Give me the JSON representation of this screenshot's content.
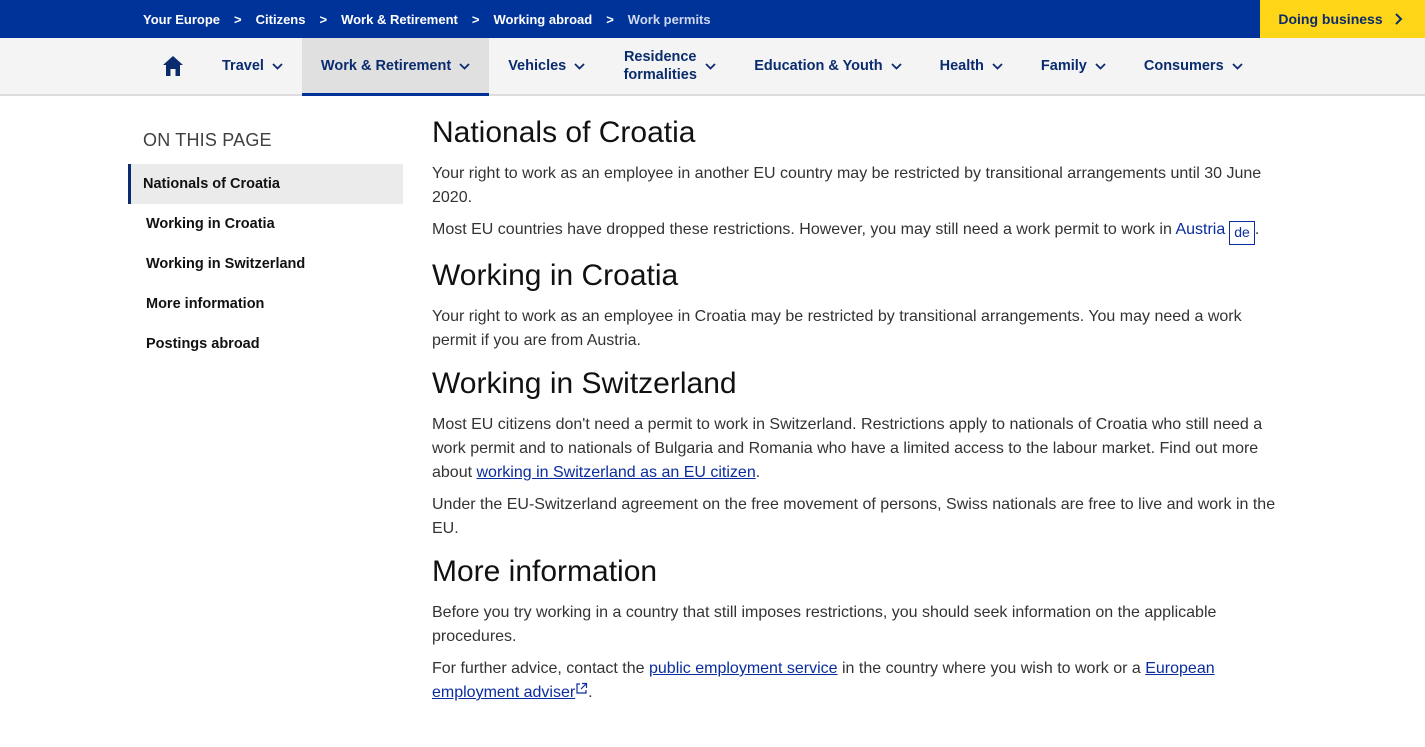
{
  "breadcrumb": {
    "items": [
      "Your Europe",
      "Citizens",
      "Work & Retirement",
      "Working abroad"
    ],
    "current": "Work permits",
    "separator": ">"
  },
  "doing_business": {
    "label": "Doing business"
  },
  "nav": {
    "home_icon": "home-icon",
    "items": [
      {
        "label": "Travel"
      },
      {
        "label": "Work & Retirement"
      },
      {
        "label": "Vehicles"
      },
      {
        "label": "Residence formalities"
      },
      {
        "label": "Education & Youth"
      },
      {
        "label": "Health"
      },
      {
        "label": "Family"
      },
      {
        "label": "Consumers"
      }
    ]
  },
  "sidebar": {
    "title": "ON THIS PAGE",
    "items": [
      {
        "label": "Nationals of Croatia"
      },
      {
        "label": "Working in Croatia"
      },
      {
        "label": "Working in Switzerland"
      },
      {
        "label": "More information"
      },
      {
        "label": "Postings abroad"
      }
    ]
  },
  "content": {
    "s1": {
      "heading": "Nationals of Croatia",
      "p1": "Your right to work as an employee in another EU country may be restricted by transitional arrangements until 30 June 2020.",
      "p2_before": "Most EU countries have dropped these restrictions. However, you may still need a work permit to work in ",
      "p2_link": "Austria",
      "p2_lang": "de",
      "p2_after": "."
    },
    "s2": {
      "heading": "Working in Croatia",
      "p1": "Your right to work as an employee in Croatia may be restricted by transitional arrangements. You may need a work permit if you are from Austria."
    },
    "s3": {
      "heading": "Working in Switzerland",
      "p1_before": "Most EU citizens don't need a permit to work in Switzerland. Restrictions apply to nationals of Croatia who still need a work permit and to nationals of Bulgaria and Romania who have a limited access to the labour market. Find out more about ",
      "p1_link": "working in Switzerland as an EU citizen",
      "p1_after": ".",
      "p2": "Under the EU-Switzerland agreement on the free movement of persons, Swiss nationals are free to live and work in the EU."
    },
    "s4": {
      "heading": "More information",
      "p1": "Before you try working in a country that still imposes restrictions, you should seek information on the applicable procedures.",
      "p2_before": "For further advice, contact the ",
      "p2_link1": "public employment service",
      "p2_mid": " in the country where you wish to work or a ",
      "p2_link2": "European employment adviser",
      "p2_after": "."
    }
  },
  "colors": {
    "brand_blue": "#003399",
    "accent_yellow": "#ffd617",
    "link": "#0a2c9e"
  }
}
